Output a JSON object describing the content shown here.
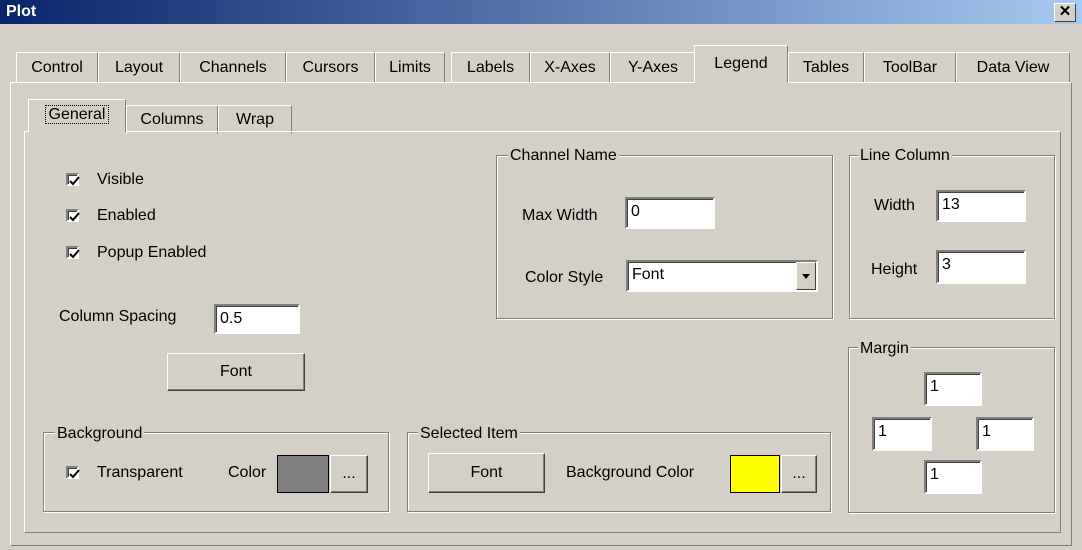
{
  "window": {
    "title": "Plot"
  },
  "tabs": [
    "Control",
    "Layout",
    "Channels",
    "Cursors",
    "Limits",
    "Labels",
    "X-Axes",
    "Y-Axes",
    "Legend",
    "Tables",
    "ToolBar",
    "Data View"
  ],
  "subtabs": [
    "General",
    "Columns",
    "Wrap"
  ],
  "general": {
    "visible": "Visible",
    "enabled": "Enabled",
    "popup_enabled": "Popup Enabled",
    "column_spacing_label": "Column Spacing",
    "column_spacing_value": "0.5",
    "font_button": "Font"
  },
  "background": {
    "title": "Background",
    "transparent": "Transparent",
    "color_label": "Color",
    "color": "#808080",
    "browse": "..."
  },
  "selected_item": {
    "title": "Selected Item",
    "font_button": "Font",
    "bg_color_label": "Background Color",
    "color": "#ffff00",
    "browse": "..."
  },
  "channel_name": {
    "title": "Channel Name",
    "max_width_label": "Max Width",
    "max_width_value": "0",
    "color_style_label": "Color Style",
    "color_style_value": "Font"
  },
  "line_column": {
    "title": "Line Column",
    "width_label": "Width",
    "width_value": "13",
    "height_label": "Height",
    "height_value": "3"
  },
  "margin": {
    "title": "Margin",
    "top": "1",
    "left": "1",
    "right": "1",
    "bottom": "1"
  }
}
